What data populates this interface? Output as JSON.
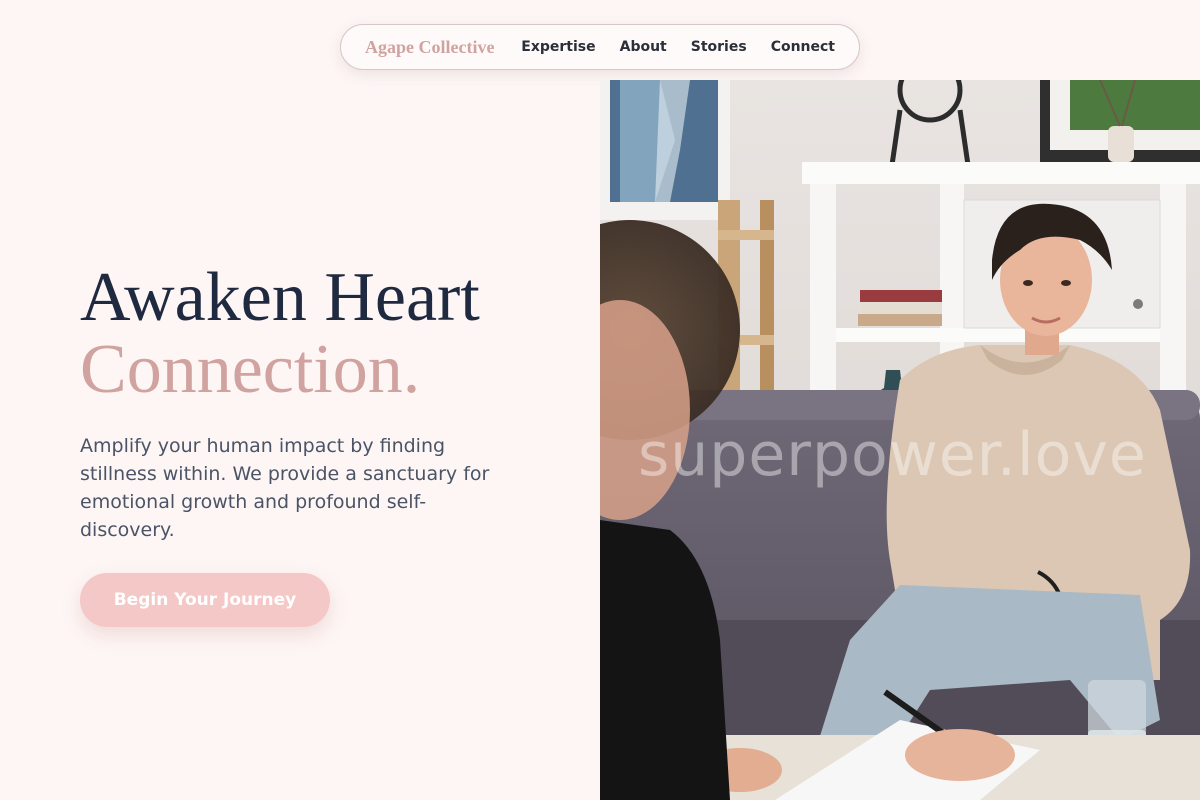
{
  "nav": {
    "brand": "Agape Collective",
    "links": [
      "Expertise",
      "About",
      "Stories",
      "Connect"
    ]
  },
  "hero": {
    "headline_line1": "Awaken Heart",
    "headline_line2": "Connection.",
    "body": "Amplify your human impact by finding stillness within. We provide a sanctuary for emotional growth and profound self-discovery.",
    "cta_label": "Begin Your Journey"
  },
  "photo": {
    "watermark": "superpower.love"
  },
  "colors": {
    "background": "#fdf6f5",
    "accent_rose": "#d1a3a0",
    "button": "#f3c8c6",
    "heading": "#1f2a40",
    "body_text": "#4b5466"
  }
}
